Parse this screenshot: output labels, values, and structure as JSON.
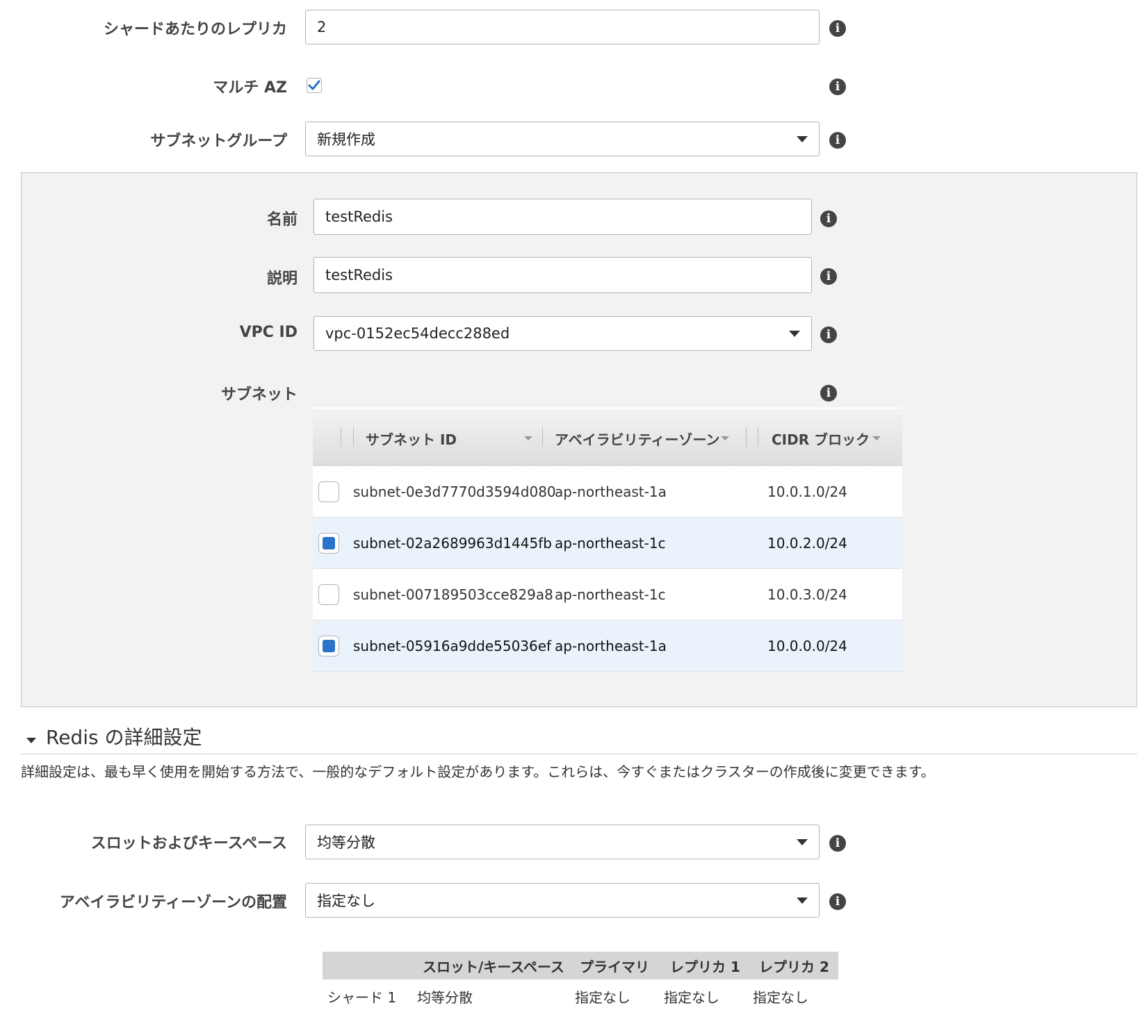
{
  "fields": {
    "replicas": {
      "label": "シャードあたりのレプリカ",
      "value": "2"
    },
    "multi_az": {
      "label": "マルチ AZ",
      "checked": true
    },
    "subnet_group": {
      "label": "サブネットグループ",
      "value": "新規作成"
    }
  },
  "panel": {
    "name": {
      "label": "名前",
      "value": "testRedis"
    },
    "description": {
      "label": "説明",
      "value": "testRedis"
    },
    "vpc": {
      "label": "VPC ID",
      "value": "vpc-0152ec54decc288ed"
    },
    "subnets_label": "サブネット",
    "table": {
      "headers": [
        "サブネット ID",
        "アベイラビリティーゾーン",
        "CIDR ブロック"
      ],
      "rows": [
        {
          "id": "subnet-0e3d7770d3594d080",
          "az": "ap-northeast-1a",
          "cidr": "10.0.1.0/24",
          "checked": false
        },
        {
          "id": "subnet-02a2689963d1445fb",
          "az": "ap-northeast-1c",
          "cidr": "10.0.2.0/24",
          "checked": true
        },
        {
          "id": "subnet-007189503cce829a8",
          "az": "ap-northeast-1c",
          "cidr": "10.0.3.0/24",
          "checked": false
        },
        {
          "id": "subnet-05916a9dde55036ef",
          "az": "ap-northeast-1a",
          "cidr": "10.0.0.0/24",
          "checked": true
        }
      ]
    }
  },
  "advanced": {
    "title": "Redis の詳細設定",
    "description": "詳細設定は、最も早く使用を開始する方法で、一般的なデフォルト設定があります。これらは、今すぐまたはクラスターの作成後に変更できます。",
    "slots": {
      "label": "スロットおよびキースペース",
      "value": "均等分散"
    },
    "az_placement": {
      "label": "アベイラビリティーゾーンの配置",
      "value": "指定なし"
    },
    "distribution": {
      "headers": [
        "スロット/キースペース",
        "プライマリ",
        "レプリカ 1",
        "レプリカ 2"
      ],
      "row": {
        "shard": "シャード 1",
        "slots": "均等分散",
        "primary": "指定なし",
        "replica1": "指定なし",
        "replica2": "指定なし"
      }
    }
  },
  "icons": {
    "info": "info-icon",
    "info_glyph": "i"
  },
  "colors": {
    "accent": "#2a73c8",
    "panel_bg": "#f2f2f2",
    "selected_row": "#eaf3fc"
  }
}
